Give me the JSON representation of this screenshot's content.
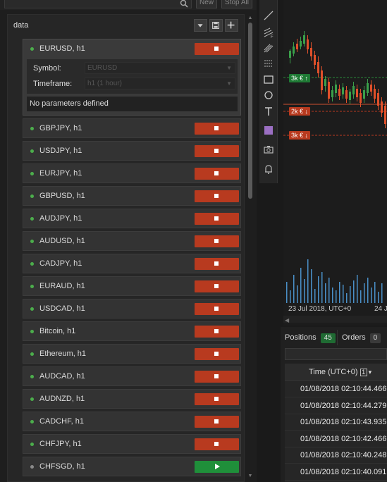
{
  "toolbar_top": {
    "new_label": "New",
    "stop_all_label": "Stop All"
  },
  "container": {
    "title": "data"
  },
  "expanded": {
    "name": "EURUSD, h1",
    "symbol_label": "Symbol:",
    "symbol_value": "EURUSD",
    "timeframe_label": "Timeframe:",
    "timeframe_value": "h1 (1 hour)",
    "no_params": "No parameters defined"
  },
  "instances": [
    {
      "name": "GBPJPY, h1",
      "state": "running"
    },
    {
      "name": "USDJPY, h1",
      "state": "running"
    },
    {
      "name": "EURJPY, h1",
      "state": "running"
    },
    {
      "name": "GBPUSD, h1",
      "state": "running"
    },
    {
      "name": "AUDJPY, h1",
      "state": "running"
    },
    {
      "name": "AUDUSD, h1",
      "state": "running"
    },
    {
      "name": "CADJPY, h1",
      "state": "running"
    },
    {
      "name": "EURAUD, h1",
      "state": "running"
    },
    {
      "name": "USDCAD, h1",
      "state": "running"
    },
    {
      "name": "Bitcoin, h1",
      "state": "running"
    },
    {
      "name": "Ethereum, h1",
      "state": "running"
    },
    {
      "name": "AUDCAD, h1",
      "state": "running"
    },
    {
      "name": "AUDNZD, h1",
      "state": "running"
    },
    {
      "name": "CADCHF, h1",
      "state": "running"
    },
    {
      "name": "CHFJPY, h1",
      "state": "running"
    },
    {
      "name": "CHFSGD, h1",
      "state": "stopped"
    }
  ],
  "chart": {
    "order_tags": [
      {
        "label": "3k € ↑",
        "color": "#1f7a35"
      },
      {
        "label": "2k € ↓",
        "color": "#b83a1f"
      },
      {
        "label": "3k € ↓",
        "color": "#b83a1f"
      }
    ],
    "date_labels": [
      "23 Jul 2018, UTC+0",
      "24 J"
    ]
  },
  "positions": {
    "tabs": [
      {
        "label": "Positions",
        "count": "45",
        "badge_color": "#1f6b33"
      },
      {
        "label": "Orders",
        "count": "0",
        "badge_color": "#3a3a3a"
      }
    ],
    "column_header": "Time (UTC+0)",
    "sort_index": "1",
    "sort_caret": "▾",
    "rows": [
      "01/08/2018 02:10:44.466",
      "01/08/2018 02:10:44.279",
      "01/08/2018 02:10:43.935",
      "01/08/2018 02:10:42.466",
      "01/08/2018 02:10:40.248",
      "01/08/2018 02:10:40.091"
    ]
  },
  "colors": {
    "stop": "#b83a1f",
    "play": "#1f8f3a",
    "running_dot": "#4cae4c",
    "accent_purple": "#9b6fc3"
  },
  "icons": [
    "search-icon",
    "menu-caret-icon",
    "save-icon",
    "plus-icon",
    "stop-icon",
    "play-icon",
    "line-tool-icon",
    "fib-icon",
    "pitchfork-icon",
    "fib-extension-icon",
    "rectangle-icon",
    "circle-icon",
    "text-icon",
    "color-swatch-icon",
    "camera-icon",
    "bell-icon"
  ]
}
